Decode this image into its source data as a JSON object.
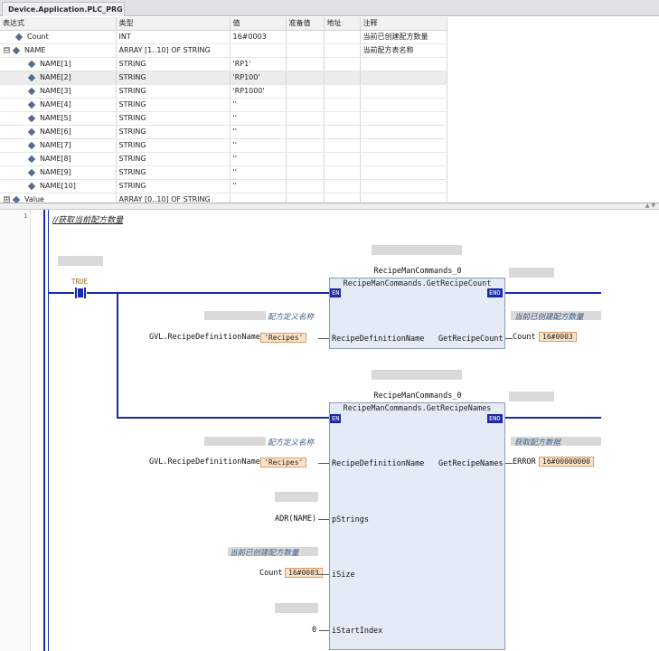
{
  "window": {
    "title": "Device.Application.PLC_PRG"
  },
  "watch": {
    "headers": [
      "表达式",
      "类型",
      "值",
      "准备值",
      "地址",
      "注释"
    ],
    "rows": [
      {
        "expr": "Count",
        "type": "INT",
        "value": "16#0003",
        "prep": "",
        "addr": "",
        "comment": "当前已创建配方数量",
        "level": 0,
        "expand": ""
      },
      {
        "expr": "NAME",
        "type": "ARRAY [1..10] OF STRING",
        "value": "",
        "prep": "",
        "addr": "",
        "comment": "当前配方表名称",
        "level": 0,
        "expand": "⊟"
      },
      {
        "expr": "NAME[1]",
        "type": "STRING",
        "value": "'RP1'",
        "prep": "",
        "addr": "",
        "comment": "",
        "level": 1,
        "expand": ""
      },
      {
        "expr": "NAME[2]",
        "type": "STRING",
        "value": "'RP100'",
        "prep": "",
        "addr": "",
        "comment": "",
        "level": 1,
        "expand": ""
      },
      {
        "expr": "NAME[3]",
        "type": "STRING",
        "value": "'RP1000'",
        "prep": "",
        "addr": "",
        "comment": "",
        "level": 1,
        "expand": ""
      },
      {
        "expr": "NAME[4]",
        "type": "STRING",
        "value": "''",
        "prep": "",
        "addr": "",
        "comment": "",
        "level": 1,
        "expand": ""
      },
      {
        "expr": "NAME[5]",
        "type": "STRING",
        "value": "''",
        "prep": "",
        "addr": "",
        "comment": "",
        "level": 1,
        "expand": ""
      },
      {
        "expr": "NAME[6]",
        "type": "STRING",
        "value": "''",
        "prep": "",
        "addr": "",
        "comment": "",
        "level": 1,
        "expand": ""
      },
      {
        "expr": "NAME[7]",
        "type": "STRING",
        "value": "''",
        "prep": "",
        "addr": "",
        "comment": "",
        "level": 1,
        "expand": ""
      },
      {
        "expr": "NAME[8]",
        "type": "STRING",
        "value": "''",
        "prep": "",
        "addr": "",
        "comment": "",
        "level": 1,
        "expand": ""
      },
      {
        "expr": "NAME[9]",
        "type": "STRING",
        "value": "''",
        "prep": "",
        "addr": "",
        "comment": "",
        "level": 1,
        "expand": ""
      },
      {
        "expr": "NAME[10]",
        "type": "STRING",
        "value": "''",
        "prep": "",
        "addr": "",
        "comment": "",
        "level": 1,
        "expand": ""
      },
      {
        "expr": "Value",
        "type": "ARRAY [0..10] OF STRING",
        "value": "",
        "prep": "",
        "addr": "",
        "comment": "",
        "level": 0,
        "expand": "⊞"
      }
    ]
  },
  "ladder": {
    "line_number": "1",
    "comment": "//获取当前配方数量",
    "contact_label": "TRUE",
    "fb1": {
      "instance": "RecipeManCommands_0",
      "name": "RecipeManCommands.GetRecipeCount",
      "en": "EN",
      "eno": "ENO",
      "in_pin": "RecipeDefinitionName",
      "out_pin": "GetRecipeCount",
      "in_var": "GVL.RecipeDefinitionName",
      "in_value": "'Recipes'",
      "in_comment": "配方定义名称",
      "out_var": "Count",
      "out_value": "16#0003",
      "out_comment": "当前已创建配方数量"
    },
    "fb2": {
      "instance": "RecipeManCommands_0",
      "name": "RecipeManCommands.GetRecipeNames",
      "en": "EN",
      "eno": "ENO",
      "in_pin": "RecipeDefinitionName",
      "out_pin": "GetRecipeNames",
      "in_var": "GVL.RecipeDefinitionName",
      "in_value": "'Recipes'",
      "in_comment": "配方定义名称",
      "out_var": "ERROR",
      "out_value": "16#00000000",
      "out_comment": "获取配方数据",
      "p_strings_pin": "pStrings",
      "p_strings_var": "ADR(NAME)",
      "isize_pin": "iSize",
      "isize_comment": "当前已创建配方数量",
      "isize_var": "Count",
      "isize_value": "16#0003",
      "istart_pin": "iStartIndex",
      "istart_var": "0"
    }
  }
}
